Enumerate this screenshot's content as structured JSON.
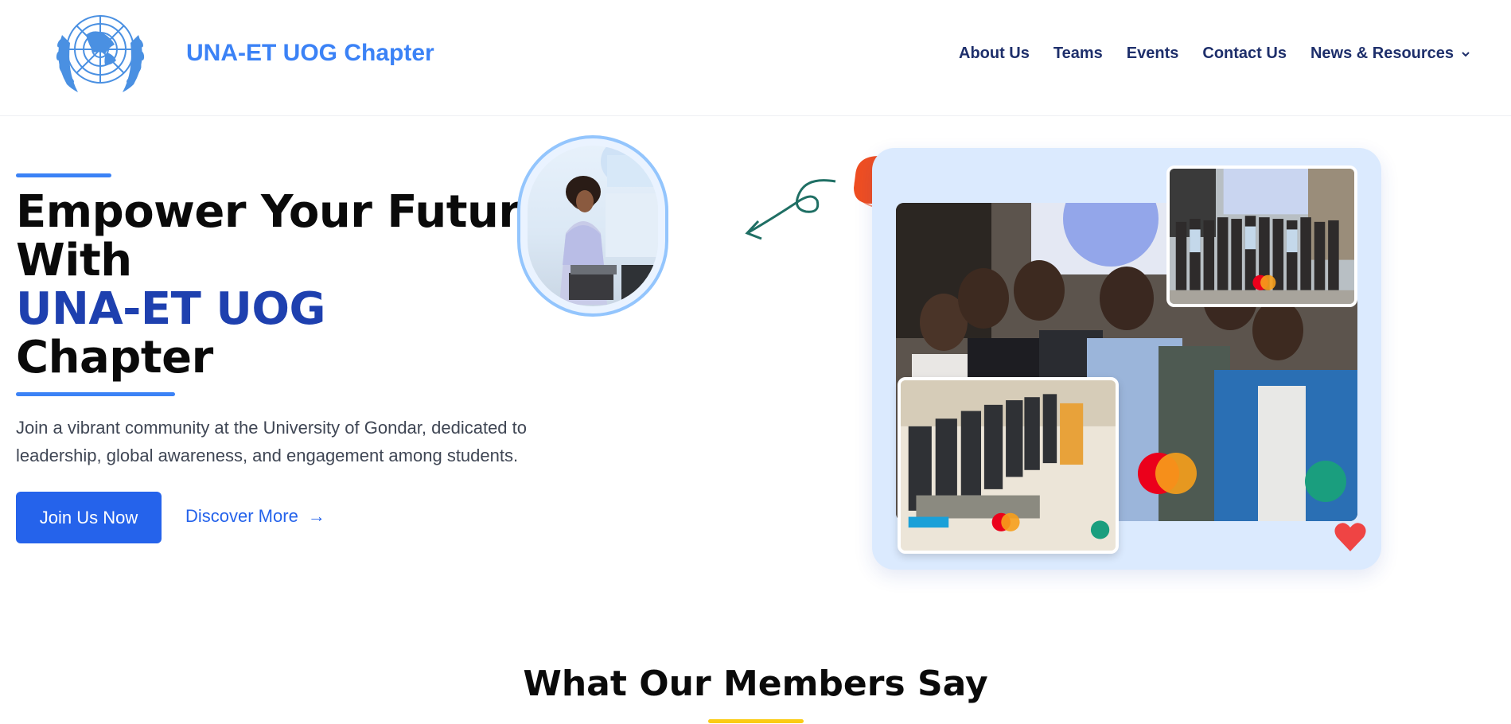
{
  "header": {
    "brand": "UNA-ET UOG Chapter",
    "logo_icon": "un-emblem-icon",
    "nav": [
      {
        "label": "About Us"
      },
      {
        "label": "Teams"
      },
      {
        "label": "Events"
      },
      {
        "label": "Contact Us"
      },
      {
        "label": "News & Resources",
        "has_dropdown": true
      }
    ]
  },
  "hero": {
    "title_line1": "Empower Your Future",
    "title_line2": "With",
    "title_highlight": "UNA-ET UOG",
    "title_line4": "Chapter",
    "description": "Join a vibrant community at the University of Gondar, dedicated to leadership, global awareness, and engagement among students.",
    "primary_button": "Join Us Now",
    "secondary_button": "Discover More",
    "secondary_arrow": "→"
  },
  "section": {
    "title": "What Our Members Say"
  },
  "colors": {
    "brand_blue": "#3b82f6",
    "button_blue": "#2563eb",
    "heading_navy": "#1e2f6b",
    "highlight_blue": "#1e40af",
    "collage_bg": "#dbeafe",
    "bubble_orange": "#ef4e22",
    "heart_red": "#ef4444",
    "accent_yellow": "#facc15"
  }
}
